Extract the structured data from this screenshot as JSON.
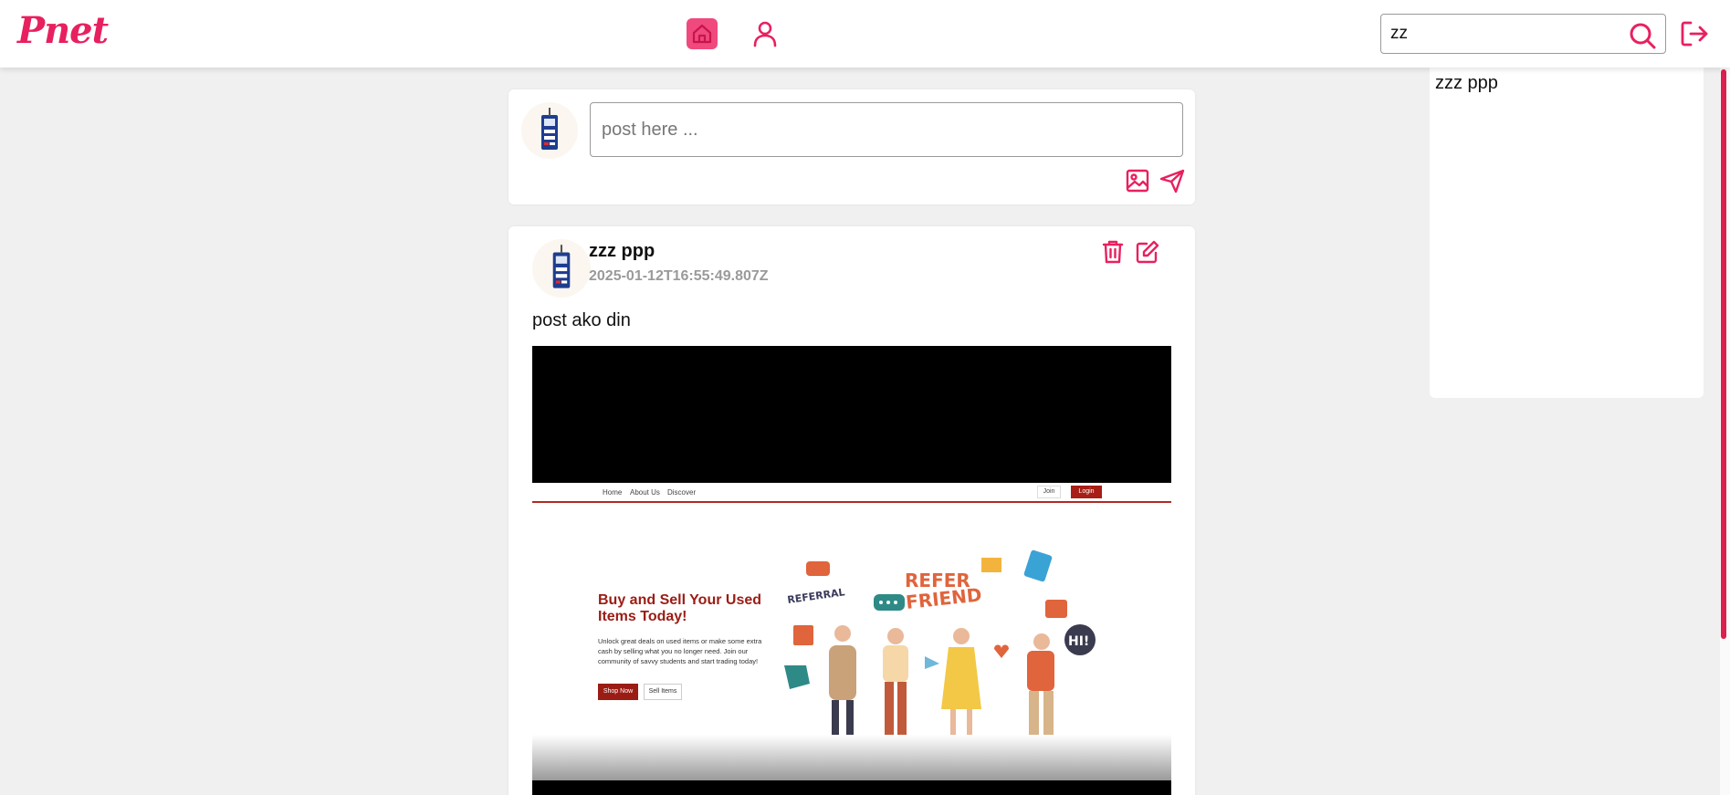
{
  "app": {
    "logo_text": "Pnet",
    "accent_color": "#e8205f"
  },
  "nav": {
    "home_icon": "home-icon",
    "profile_icon": "user-icon"
  },
  "search": {
    "value": "zz",
    "icon": "search-icon"
  },
  "logout": {
    "icon": "logout-icon"
  },
  "search_results": [
    {
      "label": "zzz ppp"
    }
  ],
  "composer": {
    "placeholder": "post here ...",
    "image_icon": "image-icon",
    "send_icon": "send-icon"
  },
  "post": {
    "author": "zzz ppp",
    "timestamp": "2025-01-12T16:55:49.807Z",
    "text": "post ako din",
    "delete_icon": "trash-icon",
    "edit_icon": "edit-icon",
    "image": {
      "nav_links": [
        "Home",
        "About Us",
        "Discover"
      ],
      "join_label": "Join",
      "login_label": "Login",
      "headline": "Buy and Sell Your Used Items Today!",
      "body": "Unlock great deals on used items or make some extra cash by selling what you no longer need. Join our community of savvy students and start trading today!",
      "shop_label": "Shop Now",
      "sell_label": "Sell Items",
      "art_words": [
        "REFERRAL",
        "REFER",
        "FRIEND",
        "HI!"
      ]
    }
  }
}
